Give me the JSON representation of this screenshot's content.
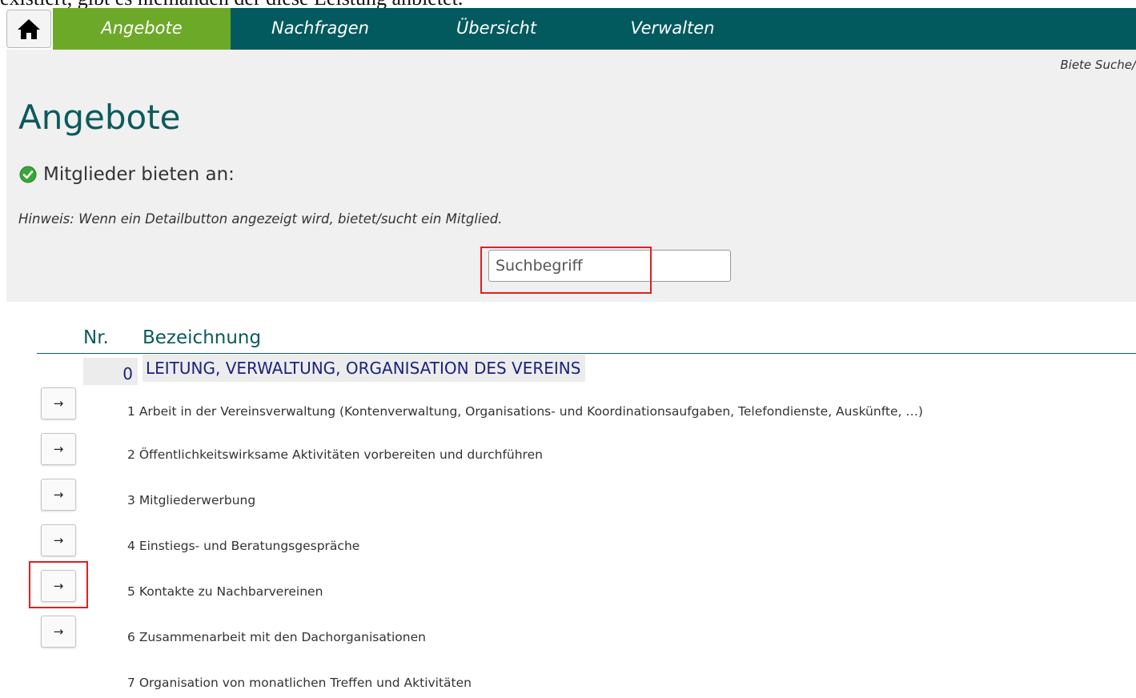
{
  "top_text": "existiert, gibt es niemanden der diese Leistung anbietet.",
  "nav": {
    "home_icon": "home-icon",
    "items": [
      {
        "label": "Angebote",
        "active": true
      },
      {
        "label": "Nachfragen",
        "active": false
      },
      {
        "label": "Übersicht",
        "active": false
      },
      {
        "label": "Verwalten",
        "active": false
      }
    ]
  },
  "hint_right": "Biete Suche/",
  "page_title": "Angebote",
  "subtitle": "Mitglieder bieten an:",
  "hint": "Hinweis: Wenn ein Detailbutton angezeigt wird, bietet/sucht ein Mitglied.",
  "search": {
    "placeholder": "Suchbegriff",
    "value": ""
  },
  "table": {
    "headers": {
      "nr": "Nr.",
      "bezeichnung": "Bezeichnung"
    },
    "category": {
      "nr": "0",
      "label": "LEITUNG, VERWALTUNG, ORGANISATION DES VEREINS"
    },
    "rows": [
      {
        "nr": "1",
        "text": "Arbeit in der Vereinsverwaltung (Kontenverwaltung, Organisations- und Koordinationsaufgaben, Telefondienste, Auskünfte, …)",
        "button": "→"
      },
      {
        "nr": "2",
        "text": "Öffentlichkeitswirksame Aktivitäten vorbereiten und durchführen",
        "button": "→"
      },
      {
        "nr": "3",
        "text": "Mitgliederwerbung",
        "button": "→"
      },
      {
        "nr": "4",
        "text": "Einstiegs- und Beratungsgespräche",
        "button": "→"
      },
      {
        "nr": "5",
        "text": "Kontakte zu Nachbarvereinen",
        "button": "→"
      },
      {
        "nr": "6",
        "text": "Zusammenarbeit mit den Dachorganisationen",
        "button": "→"
      },
      {
        "nr": "7",
        "text": "Organisation von monatlichen Treffen und Aktivitäten",
        "button": ""
      }
    ]
  },
  "colors": {
    "nav_bg": "#035a5e",
    "nav_active": "#6da929",
    "title": "#0b5a5e",
    "highlight": "#e02020"
  }
}
